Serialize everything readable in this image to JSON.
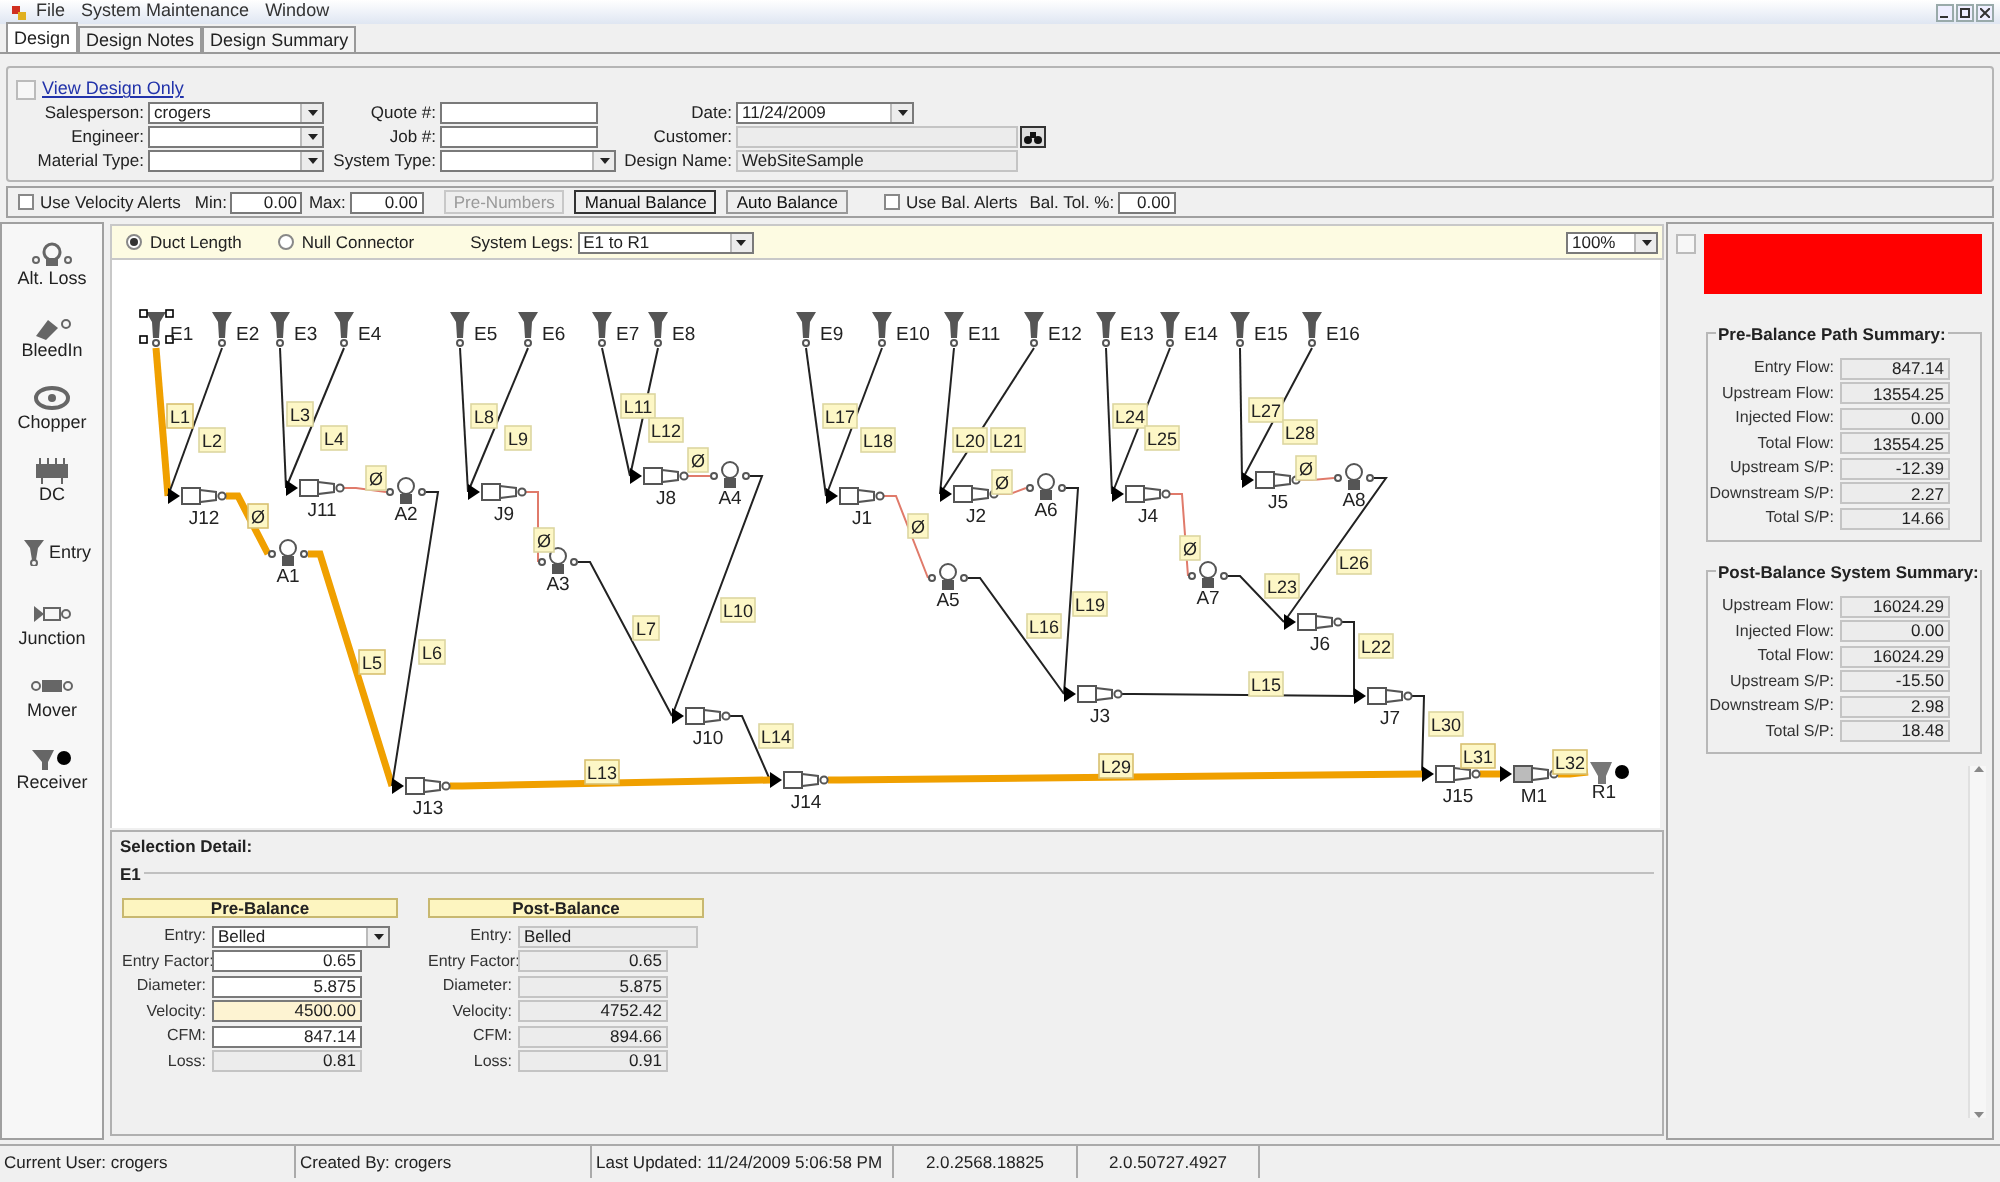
{
  "menu": [
    "File",
    "System Maintenance",
    "Window"
  ],
  "tabs": [
    {
      "label": "Design",
      "selected": true
    },
    {
      "label": "Design Notes",
      "selected": false
    },
    {
      "label": "Design Summary",
      "selected": false
    }
  ],
  "view_design_link": "View Design Only",
  "form": {
    "columns": [
      [
        {
          "label": "Salesperson:",
          "kind": "combo",
          "value": "crogers"
        },
        {
          "label": "Engineer:",
          "kind": "combo"
        },
        {
          "label": "Material Type:",
          "kind": "combo"
        }
      ],
      [
        {
          "label": "Quote #:",
          "kind": "text"
        },
        {
          "label": "Job #:",
          "kind": "text"
        },
        {
          "label": "System Type:",
          "kind": "combo"
        }
      ],
      [
        {
          "label": "Date:",
          "kind": "combo",
          "value": "11/24/2009"
        },
        {
          "label": "Customer:",
          "kind": "readonly",
          "lookup": true
        },
        {
          "label": "Design Name:",
          "kind": "readonly",
          "value": "WebSiteSample"
        }
      ]
    ]
  },
  "balance_bar": {
    "velocity_alerts": {
      "label": "Use Velocity Alerts",
      "checked": false
    },
    "min": {
      "label": "Min:",
      "value": "0.00"
    },
    "max": {
      "label": "Max:",
      "value": "0.00"
    },
    "buttons": [
      {
        "label": "Pre-Numbers",
        "disabled": true,
        "focused": false
      },
      {
        "label": "Manual Balance",
        "disabled": false,
        "focused": true
      },
      {
        "label": "Auto Balance",
        "disabled": false,
        "focused": false
      }
    ],
    "bal_alerts": {
      "label": "Use Bal. Alerts",
      "checked": false
    },
    "tolerance": {
      "label": "Bal. Tol. %:",
      "value": "0.00"
    }
  },
  "toolbox": [
    {
      "label": "Alt. Loss",
      "kind": "alt_loss"
    },
    {
      "label": "BleedIn",
      "kind": "bleedin"
    },
    {
      "label": "Chopper",
      "kind": "chopper"
    },
    {
      "label": "DC",
      "kind": "dc"
    },
    {
      "label": "Entry",
      "kind": "entry"
    },
    {
      "label": "Junction",
      "kind": "junction"
    },
    {
      "label": "Mover",
      "kind": "mover"
    },
    {
      "label": "Receiver",
      "kind": "receiver"
    }
  ],
  "diagram_header": {
    "options": [
      {
        "label": "Duct Length",
        "selected": true
      },
      {
        "label": "Null Connector",
        "selected": false
      }
    ],
    "legs": {
      "label": "System Legs:",
      "value": "E1 to R1"
    },
    "zoom": "100%"
  },
  "diagram": {
    "nodes": [
      {
        "label": "E1",
        "kind": "entry",
        "selected": true
      },
      {
        "label": "E2",
        "kind": "entry",
        "selected": false
      },
      {
        "label": "E3",
        "kind": "entry",
        "selected": false
      },
      {
        "label": "E4",
        "kind": "entry",
        "selected": false
      },
      {
        "label": "E5",
        "kind": "entry",
        "selected": false
      },
      {
        "label": "E6",
        "kind": "entry",
        "selected": false
      },
      {
        "label": "E7",
        "kind": "entry",
        "selected": false
      },
      {
        "label": "E8",
        "kind": "entry",
        "selected": false
      },
      {
        "label": "E9",
        "kind": "entry",
        "selected": false
      },
      {
        "label": "E10",
        "kind": "entry",
        "selected": false
      },
      {
        "label": "E11",
        "kind": "entry",
        "selected": false
      },
      {
        "label": "E12",
        "kind": "entry",
        "selected": false
      },
      {
        "label": "E13",
        "kind": "entry",
        "selected": false
      },
      {
        "label": "E14",
        "kind": "entry",
        "selected": false
      },
      {
        "label": "E15",
        "kind": "entry",
        "selected": false
      },
      {
        "label": "E16",
        "kind": "entry",
        "selected": false
      },
      {
        "label": "J1",
        "kind": "junction",
        "selected": false
      },
      {
        "label": "J2",
        "kind": "junction",
        "selected": false
      },
      {
        "label": "J3",
        "kind": "junction",
        "selected": false
      },
      {
        "label": "J4",
        "kind": "junction",
        "selected": false
      },
      {
        "label": "J5",
        "kind": "junction",
        "selected": false
      },
      {
        "label": "J6",
        "kind": "junction",
        "selected": false
      },
      {
        "label": "J7",
        "kind": "junction",
        "selected": false
      },
      {
        "label": "J8",
        "kind": "junction",
        "selected": false
      },
      {
        "label": "J9",
        "kind": "junction",
        "selected": false
      },
      {
        "label": "J10",
        "kind": "junction",
        "selected": false
      },
      {
        "label": "J11",
        "kind": "junction",
        "selected": false
      },
      {
        "label": "J12",
        "kind": "junction",
        "selected": false
      },
      {
        "label": "J13",
        "kind": "junction",
        "selected": false
      },
      {
        "label": "J14",
        "kind": "junction",
        "selected": false
      },
      {
        "label": "J15",
        "kind": "junction",
        "selected": false
      },
      {
        "label": "A1",
        "kind": "regulator",
        "selected": false
      },
      {
        "label": "A2",
        "kind": "regulator",
        "selected": false
      },
      {
        "label": "A3",
        "kind": "regulator",
        "selected": false
      },
      {
        "label": "A4",
        "kind": "regulator",
        "selected": false
      },
      {
        "label": "A5",
        "kind": "regulator",
        "selected": false
      },
      {
        "label": "A6",
        "kind": "regulator",
        "selected": false
      },
      {
        "label": "A7",
        "kind": "regulator",
        "selected": false
      },
      {
        "label": "A8",
        "kind": "regulator",
        "selected": false
      },
      {
        "label": "M1",
        "kind": "mover",
        "selected": false
      },
      {
        "label": "R1",
        "kind": "receiver",
        "selected": false
      }
    ],
    "ducts": [
      {
        "label": "L1",
        "kind": "duct",
        "highlighted": true
      },
      {
        "label": "L2",
        "kind": "duct",
        "highlighted": false
      },
      {
        "label": "L3",
        "kind": "duct",
        "highlighted": false
      },
      {
        "label": "L4",
        "kind": "duct",
        "highlighted": false
      },
      {
        "label": "Ø",
        "kind": "null",
        "highlighted": false
      },
      {
        "label": "L8",
        "kind": "duct",
        "highlighted": false
      },
      {
        "label": "L9",
        "kind": "duct",
        "highlighted": false
      },
      {
        "label": "L11",
        "kind": "duct",
        "highlighted": false
      },
      {
        "label": "L12",
        "kind": "duct",
        "highlighted": false
      },
      {
        "label": "Ø",
        "kind": "null",
        "highlighted": false
      },
      {
        "label": "Ø",
        "kind": "null",
        "highlighted": true
      },
      {
        "label": "L5",
        "kind": "duct",
        "highlighted": true
      },
      {
        "label": "L6",
        "kind": "duct",
        "highlighted": false
      },
      {
        "label": "Ø",
        "kind": "null",
        "highlighted": false
      },
      {
        "label": "L7",
        "kind": "duct",
        "highlighted": false
      },
      {
        "label": "L10",
        "kind": "duct",
        "highlighted": false
      },
      {
        "label": "L14",
        "kind": "duct",
        "highlighted": false
      },
      {
        "label": "L13",
        "kind": "duct",
        "highlighted": true
      },
      {
        "label": "L17",
        "kind": "duct",
        "highlighted": false
      },
      {
        "label": "L18",
        "kind": "duct",
        "highlighted": false
      },
      {
        "label": "Ø",
        "kind": "null",
        "highlighted": false
      },
      {
        "label": "L20",
        "kind": "duct",
        "highlighted": false
      },
      {
        "label": "L21",
        "kind": "duct",
        "highlighted": false
      },
      {
        "label": "Ø",
        "kind": "null",
        "highlighted": false
      },
      {
        "label": "L24",
        "kind": "duct",
        "highlighted": false
      },
      {
        "label": "L25",
        "kind": "duct",
        "highlighted": false
      },
      {
        "label": "Ø",
        "kind": "null",
        "highlighted": false
      },
      {
        "label": "L27",
        "kind": "duct",
        "highlighted": false
      },
      {
        "label": "L28",
        "kind": "duct",
        "highlighted": false
      },
      {
        "label": "Ø",
        "kind": "null",
        "highlighted": false
      },
      {
        "label": "L16",
        "kind": "duct",
        "highlighted": false
      },
      {
        "label": "L19",
        "kind": "duct",
        "highlighted": false
      },
      {
        "label": "L23",
        "kind": "duct",
        "highlighted": false
      },
      {
        "label": "L26",
        "kind": "duct",
        "highlighted": false
      },
      {
        "label": "L22",
        "kind": "duct",
        "highlighted": false
      },
      {
        "label": "L15",
        "kind": "duct",
        "highlighted": false
      },
      {
        "label": "L30",
        "kind": "duct",
        "highlighted": false
      },
      {
        "label": "L29",
        "kind": "duct",
        "highlighted": true
      },
      {
        "label": "L31",
        "kind": "duct",
        "highlighted": true
      },
      {
        "label": "L32",
        "kind": "duct",
        "highlighted": true
      }
    ]
  },
  "selection_detail": {
    "title": "Selection Detail:",
    "item": "E1",
    "pre": {
      "title": "Pre-Balance",
      "rows": [
        {
          "label": "Entry:",
          "value": "Belled",
          "kind": "combo"
        },
        {
          "label": "Entry Factor:",
          "value": "0.65",
          "kind": "text"
        },
        {
          "label": "Diameter:",
          "value": "5.875",
          "kind": "text"
        },
        {
          "label": "Velocity:",
          "value": "4500.00",
          "kind": "highlight"
        },
        {
          "label": "CFM:",
          "value": "847.14",
          "kind": "text"
        },
        {
          "label": "Loss:",
          "value": "0.81",
          "kind": "readonly"
        }
      ]
    },
    "post": {
      "title": "Post-Balance",
      "rows": [
        {
          "label": "Entry:",
          "value": "Belled",
          "kind": "readonly"
        },
        {
          "label": "Entry Factor:",
          "value": "0.65",
          "kind": "readonly"
        },
        {
          "label": "Diameter:",
          "value": "5.875",
          "kind": "readonly"
        },
        {
          "label": "Velocity:",
          "value": "4752.42",
          "kind": "readonly"
        },
        {
          "label": "CFM:",
          "value": "894.66",
          "kind": "readonly"
        },
        {
          "label": "Loss:",
          "value": "0.91",
          "kind": "readonly"
        }
      ]
    }
  },
  "right_panel": {
    "summaries": [
      {
        "title": "Pre-Balance Path Summary:",
        "rows": [
          {
            "label": "Entry Flow:",
            "value": "847.14"
          },
          {
            "label": "Upstream Flow:",
            "value": "13554.25"
          },
          {
            "label": "Injected Flow:",
            "value": "0.00"
          },
          {
            "label": "Total Flow:",
            "value": "13554.25"
          },
          {
            "label": "Upstream S/P:",
            "value": "-12.39"
          },
          {
            "label": "Downstream S/P:",
            "value": "2.27"
          },
          {
            "label": "Total S/P:",
            "value": "14.66"
          }
        ]
      },
      {
        "title": "Post-Balance System Summary:",
        "rows": [
          {
            "label": "Upstream Flow:",
            "value": "16024.29"
          },
          {
            "label": "Injected Flow:",
            "value": "0.00"
          },
          {
            "label": "Total Flow:",
            "value": "16024.29"
          },
          {
            "label": "Upstream S/P:",
            "value": "-15.50"
          },
          {
            "label": "Downstream S/P:",
            "value": "2.98"
          },
          {
            "label": "Total S/P:",
            "value": "18.48"
          }
        ]
      }
    ]
  },
  "status_bar": [
    "Current User: crogers",
    "Created By: crogers",
    "Last Updated: 11/24/2009 5:06:58 PM",
    "2.0.2568.18825",
    "2.0.50727.4927"
  ]
}
